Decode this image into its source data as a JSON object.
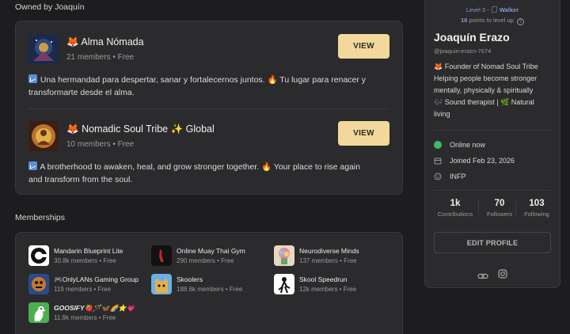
{
  "owned": {
    "heading": "Owned by Joaquín",
    "groups": [
      {
        "emoji": "🦊",
        "name": "Alma Nómada",
        "meta": "21 members • Free",
        "button": "VIEW",
        "description": "Una hermandad para despertar, sanar y fortalecernos juntos. 🔥 Tu lugar para renacer y transformarte desde el alma."
      },
      {
        "emoji": "🦊",
        "name": "Nomadic Soul Tribe ✨ Global",
        "meta": "10 members • Free",
        "button": "VIEW",
        "description": "A brotherhood to awaken, heal, and grow stronger together. 🔥 Your place to rise again and transform from the soul."
      }
    ]
  },
  "memberships": {
    "heading": "Memberships",
    "items": [
      {
        "name": "Mandarin Blueprint Lite",
        "meta": "30.8k members • Free"
      },
      {
        "name": "Online Muay Thai Gym",
        "meta": "290 members • Free"
      },
      {
        "name": "Neurodiverse Minds",
        "meta": "137 members • Free"
      },
      {
        "name": "🎮OnlyLANs Gaming Group",
        "meta": "119 members • Free"
      },
      {
        "name": "Skoolers",
        "meta": "188.6k members • Free"
      },
      {
        "name": "Skool Speedrun",
        "meta": "12k members • Free"
      },
      {
        "name": "GOOSIFY🍓🪄🦋🌈⭐💗",
        "meta": "11.9k members • Free"
      }
    ]
  },
  "profile": {
    "level": "Level 3 -",
    "level_title": "Walker",
    "points_value": "16",
    "points_text": "points to level up",
    "name": "Joaquín Erazo",
    "handle": "@joaquin-erazo-7674",
    "bio_lines": [
      "🦊 Founder of Nomad Soul Tribe",
      "Helping people become stronger",
      "mentally, physically & spiritually",
      "🎶 Sound therapist | 🌿 Natural",
      "living"
    ],
    "status": "Online now",
    "joined": "Joined Feb 23, 2026",
    "personality": "INFP",
    "stats": [
      {
        "value": "1k",
        "label": "Contributions"
      },
      {
        "value": "70",
        "label": "Followers"
      },
      {
        "value": "103",
        "label": "Following"
      }
    ],
    "edit_button": "EDIT PROFILE"
  },
  "colors": {
    "background": "#1d1d1f",
    "card": "#2b2b2d",
    "view_button": "#f2d89a",
    "level_text": "#7f9bd6",
    "online_dot": "#3fb96a"
  }
}
